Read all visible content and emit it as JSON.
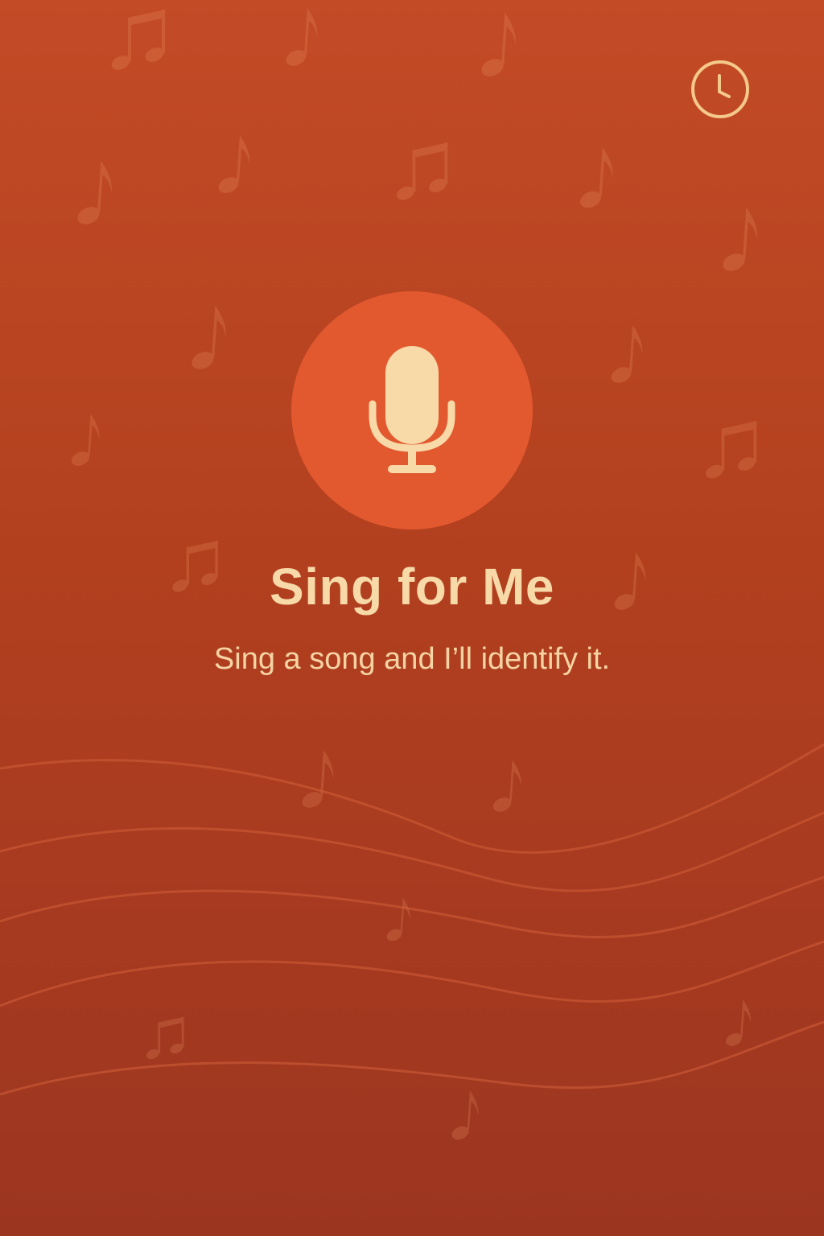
{
  "app": {
    "title": "Sing for Me",
    "subtitle": "Sing a song and I’ll identify it."
  },
  "header": {
    "history_icon": "clock-icon"
  },
  "main": {
    "mic_icon": "microphone-icon"
  },
  "background": {
    "decoration_icon": "music-note-icon",
    "wave_icon": "wave-lines"
  },
  "colors": {
    "background_top": "#c34b26",
    "background_bottom": "#9c3520",
    "mic_circle": "#e3592f",
    "accent_cream": "#f8d9a8"
  }
}
